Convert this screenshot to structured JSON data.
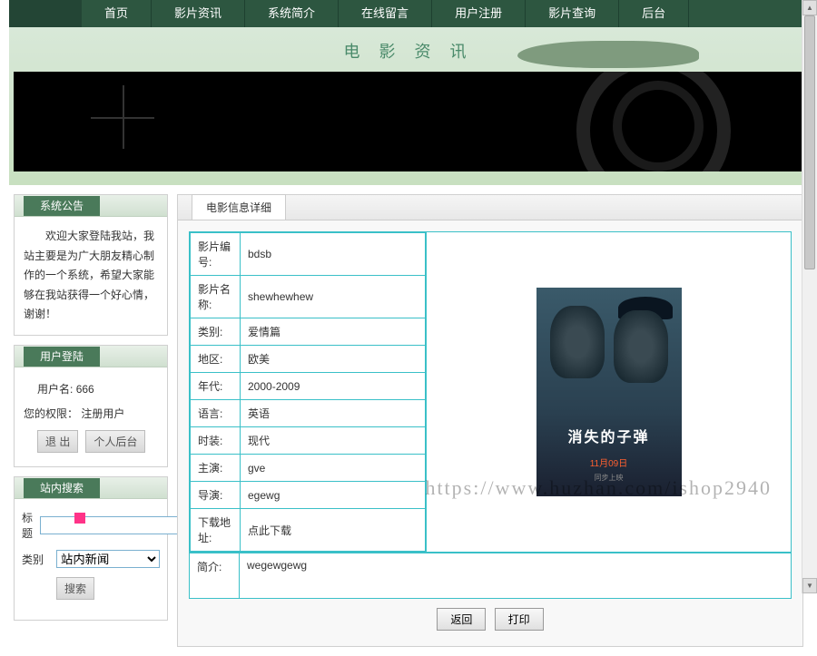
{
  "nav": {
    "items": [
      "首页",
      "影片资讯",
      "系统简介",
      "在线留言",
      "用户注册",
      "影片查询",
      "后台"
    ]
  },
  "banner": {
    "title_text": "电 影 资 讯"
  },
  "sidebar": {
    "announce": {
      "title": "系统公告",
      "text": "欢迎大家登陆我站，我站主要是为广大朋友精心制作的一个系统，希望大家能够在我站获得一个好心情，谢谢！"
    },
    "login": {
      "title": "用户登陆",
      "username_label": "用户名:",
      "username_value": "666",
      "role_label": "您的权限：",
      "role_value": "注册用户",
      "logout_btn": "退 出",
      "personal_btn": "个人后台"
    },
    "search": {
      "title": "站内搜索",
      "field_label": "标题",
      "field_value": "",
      "cat_label": "类别",
      "cat_value": "站内新闻",
      "cat_options": [
        "站内新闻"
      ],
      "submit": "搜索"
    }
  },
  "main": {
    "tab_label": "电影信息详细",
    "rows": [
      {
        "label": "影片编号:",
        "value": "bdsb"
      },
      {
        "label": "影片名称:",
        "value": "shewhewhew"
      },
      {
        "label": "类别:",
        "value": "爱情篇"
      },
      {
        "label": "地区:",
        "value": "欧美"
      },
      {
        "label": "年代:",
        "value": "2000-2009"
      },
      {
        "label": "语言:",
        "value": "英语"
      },
      {
        "label": "时装:",
        "value": "现代"
      },
      {
        "label": "主演:",
        "value": "gve"
      },
      {
        "label": "导演:",
        "value": "egewg"
      },
      {
        "label": "下载地址:",
        "value": "点此下载"
      }
    ],
    "intro_label": "简介:",
    "intro_value": "wegewgewg",
    "poster_title": "消失的子弹",
    "poster_date": "11月09日",
    "poster_sub": "同步上映",
    "back_btn": "返回",
    "print_btn": "打印"
  },
  "watermark": "https://www.huzhan.com/ishop2940"
}
